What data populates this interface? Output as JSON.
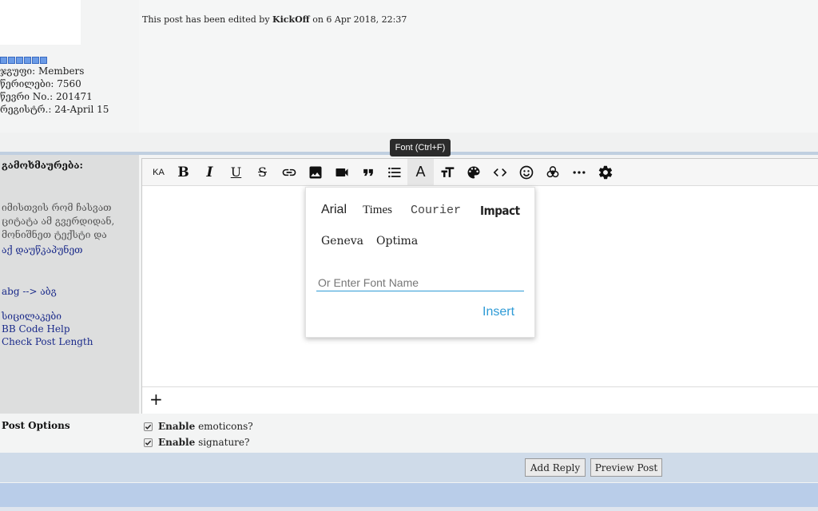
{
  "post": {
    "edit_prefix": "This post has been edited by",
    "edit_user": "KickOff",
    "edit_suffix": "on 6 Apr 2018, 22:37",
    "group_label": "ჯგუფი: Members",
    "posts_label": "წერილები: 7560",
    "member_no_label": "წევრი No.: 201471",
    "registered_label": "რეგისტრ.: 24-April 15"
  },
  "reply": {
    "title": "გამოხმაურება:",
    "hint_lines": [
      "იმისთვის რომ ჩასვათ",
      "ციტატა ამ გვერდიდან,",
      "მონიშნეთ ტექსტი და"
    ],
    "hint_link": "აქ დაუწკაპუნეთ",
    "abg_link": "abg --> აბგ",
    "smilies_link": "სიცილაკები",
    "bbcode_link": "BB Code Help",
    "check_length_link": "Check Post Length"
  },
  "toolbar": {
    "buttons": [
      {
        "name": "ka-layout",
        "label": "KA"
      },
      {
        "name": "bold",
        "label": "B"
      },
      {
        "name": "italic",
        "label": "I"
      },
      {
        "name": "underline",
        "label": "U"
      },
      {
        "name": "strike",
        "label": "S"
      },
      {
        "name": "link",
        "label": ""
      },
      {
        "name": "image",
        "label": ""
      },
      {
        "name": "video",
        "label": ""
      },
      {
        "name": "quote",
        "label": ""
      },
      {
        "name": "list",
        "label": ""
      },
      {
        "name": "font",
        "label": "A"
      },
      {
        "name": "size",
        "label": ""
      },
      {
        "name": "color",
        "label": ""
      },
      {
        "name": "code",
        "label": ""
      },
      {
        "name": "emoji",
        "label": ""
      },
      {
        "name": "biohazard",
        "label": ""
      },
      {
        "name": "more",
        "label": ""
      },
      {
        "name": "settings",
        "label": ""
      }
    ],
    "tooltip": "Font (Ctrl+F)",
    "add_label": "+"
  },
  "font_panel": {
    "options": [
      "Arial",
      "Times",
      "Courier",
      "Impact",
      "Geneva",
      "Optima"
    ],
    "input_placeholder": "Or Enter Font Name",
    "insert_label": "Insert"
  },
  "options": {
    "title": "Post Options",
    "emoticons_bold": "Enable",
    "emoticons_rest": "emoticons?",
    "signature_bold": "Enable",
    "signature_rest": "signature?"
  },
  "buttons": {
    "add_reply": "Add Reply",
    "preview": "Preview Post"
  },
  "colors": {
    "accent": "#2e9bd6",
    "link": "#1a2a8a",
    "bar": "#cfdbe9"
  }
}
